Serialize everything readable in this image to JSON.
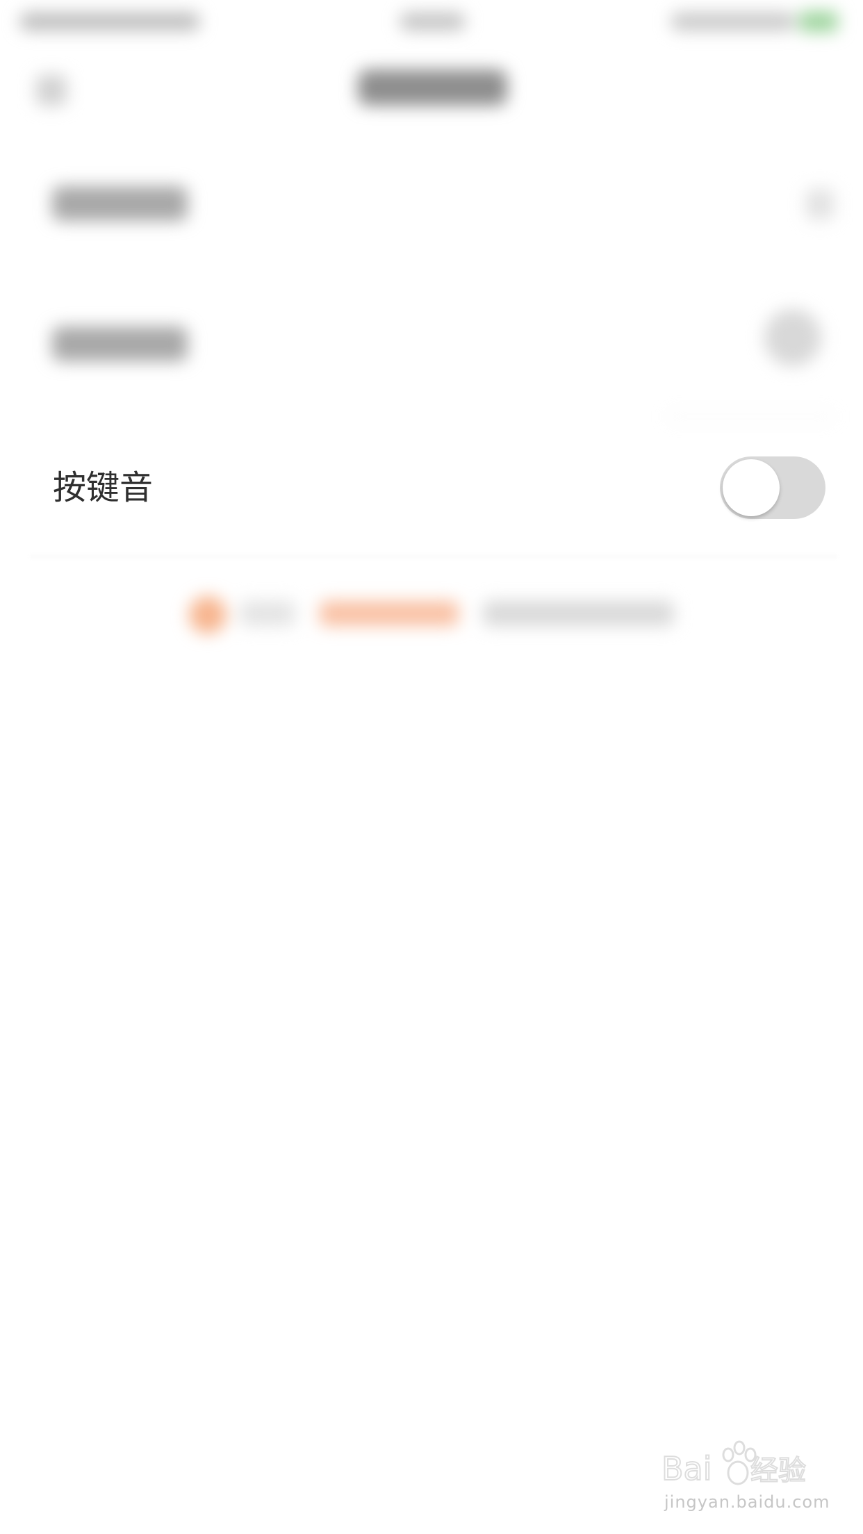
{
  "settings": {
    "key_sound": {
      "label": "按键音",
      "enabled": false
    }
  },
  "watermark": {
    "brand": "Baidu经验",
    "url": "jingyan.baidu.com"
  },
  "colors": {
    "toggle_off_track": "#d9d9d9",
    "label_text": "#2f2f2f",
    "accent_blurred": "#f9c1a4"
  },
  "icons": {
    "back": "back-arrow-icon",
    "row_chevron": "chevron-right-icon",
    "feedback": "feedback-dot-icon",
    "watermark": "baidu-paw-logo"
  }
}
